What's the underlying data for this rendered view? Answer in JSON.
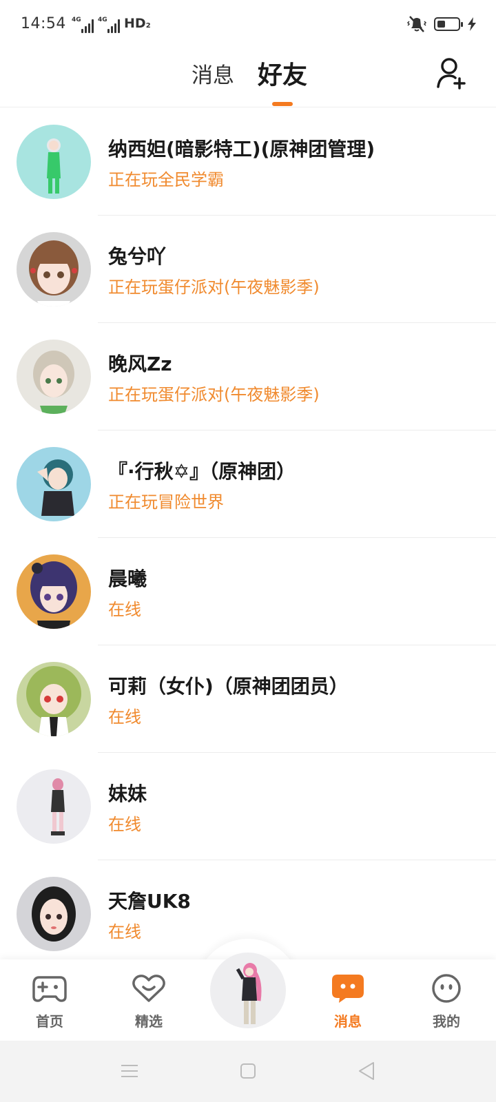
{
  "status_bar": {
    "time": "14:54",
    "network_1": "4G",
    "network_2": "4G",
    "hd": "HD",
    "hd_sub": "2",
    "icons": [
      "signal-icon",
      "mute-vibrate-icon",
      "battery-icon",
      "charging-icon"
    ],
    "battery_level": 0.3
  },
  "header": {
    "tabs": [
      {
        "label": "消息",
        "active": false
      },
      {
        "label": "好友",
        "active": true
      }
    ],
    "add_friend_icon": "add-user-icon"
  },
  "friends": [
    {
      "name": "纳西妲(暗影特工)(原神团管理)",
      "status": "正在玩全民学霸",
      "avatar_bg": "#a8e4e0"
    },
    {
      "name": "兔兮吖",
      "status": "正在玩蛋仔派对(午夜魅影季)",
      "avatar_bg": "#d6d6d6"
    },
    {
      "name": "晚风Zz",
      "status": "正在玩蛋仔派对(午夜魅影季)",
      "avatar_bg": "#e8e6e0"
    },
    {
      "name": "『·行秋✡』（原神团）",
      "status": "正在玩冒险世界",
      "avatar_bg": "#9ed6e6"
    },
    {
      "name": "晨曦",
      "status": "在线",
      "avatar_bg": "#e8a64a"
    },
    {
      "name": "可莉（女仆)（原神团团员）",
      "status": "在线",
      "avatar_bg": "#c8d6a0"
    },
    {
      "name": "妹妹",
      "status": "在线",
      "avatar_bg": "#ececf0"
    },
    {
      "name": "天詹UK8",
      "status": "在线",
      "avatar_bg": "#d4d4d8"
    }
  ],
  "bottom_nav": {
    "items": [
      {
        "label": "首页",
        "icon": "gamepad-icon",
        "active": false
      },
      {
        "label": "精选",
        "icon": "heart-chat-icon",
        "active": false
      },
      {
        "label": "消息",
        "icon": "message-bubble-icon",
        "active": true
      },
      {
        "label": "我的",
        "icon": "face-icon",
        "active": false
      }
    ],
    "center_icon": "avatar-character-icon"
  },
  "colors": {
    "accent": "#f47a20",
    "status_text": "#f08a2e",
    "name_text": "#1a1a1a"
  },
  "system_nav": {
    "icons": [
      "menu-icon",
      "home-square-icon",
      "back-triangle-icon"
    ]
  }
}
